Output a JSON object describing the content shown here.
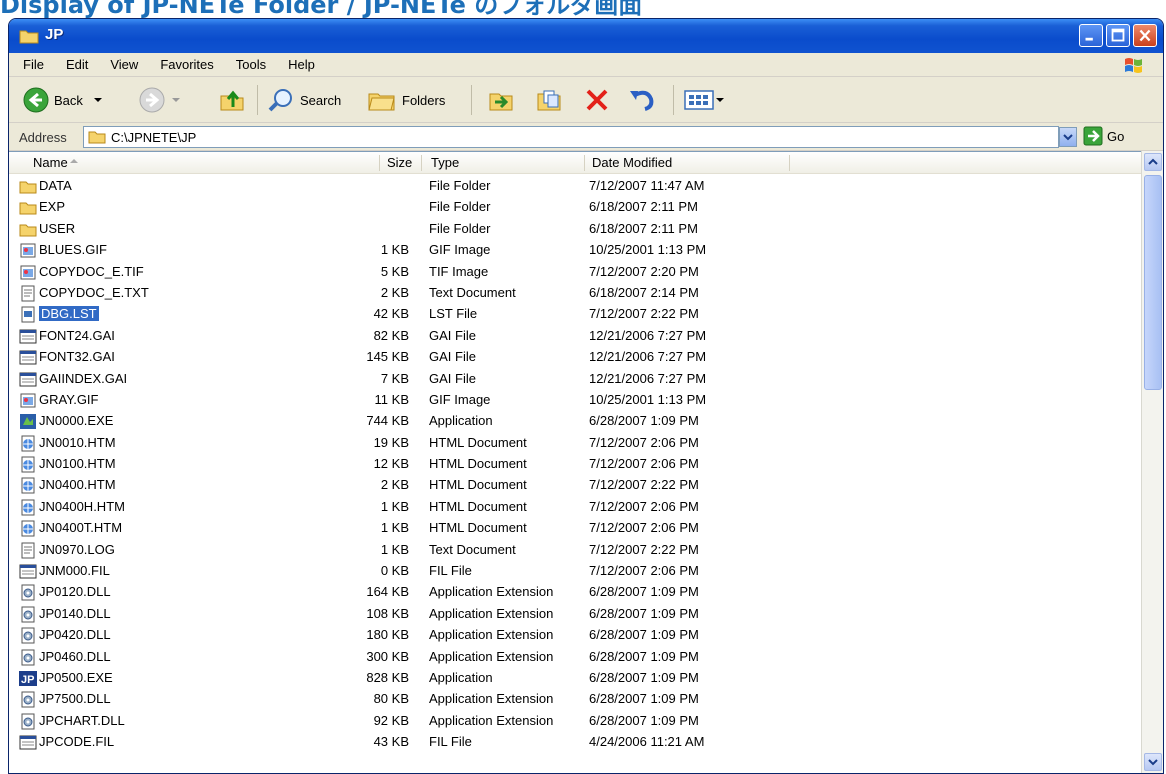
{
  "caption": "Display of JP-NETe Folder / JP-NETe のフォルダ画面",
  "window": {
    "title": "JP",
    "caption_buttons": [
      "minimize-icon",
      "maximize-icon",
      "close-icon"
    ]
  },
  "menu": [
    "File",
    "Edit",
    "View",
    "Favorites",
    "Tools",
    "Help"
  ],
  "toolbar": {
    "back": "Back",
    "search": "Search",
    "folders": "Folders"
  },
  "address": {
    "label": "Address",
    "value": "C:\\JPNETE\\JP",
    "go": "Go"
  },
  "columns": {
    "name": "Name",
    "size": "Size",
    "type": "Type",
    "date": "Date Modified"
  },
  "files": [
    {
      "name": "DATA",
      "size": "",
      "type": "File Folder",
      "date": "7/12/2007 11:47 AM",
      "icon": "folder"
    },
    {
      "name": "EXP",
      "size": "",
      "type": "File Folder",
      "date": "6/18/2007 2:11 PM",
      "icon": "folder"
    },
    {
      "name": "USER",
      "size": "",
      "type": "File Folder",
      "date": "6/18/2007 2:11 PM",
      "icon": "folder"
    },
    {
      "name": "BLUES.GIF",
      "size": "1 KB",
      "type": "GIF Image",
      "date": "10/25/2001 1:13 PM",
      "icon": "image"
    },
    {
      "name": "COPYDOC_E.TIF",
      "size": "5 KB",
      "type": "TIF Image",
      "date": "7/12/2007 2:20 PM",
      "icon": "image"
    },
    {
      "name": "COPYDOC_E.TXT",
      "size": "2 KB",
      "type": "Text Document",
      "date": "6/18/2007 2:14 PM",
      "icon": "text"
    },
    {
      "name": "DBG.LST",
      "size": "42 KB",
      "type": "LST File",
      "date": "7/12/2007 2:22 PM",
      "icon": "file",
      "selected": true
    },
    {
      "name": "FONT24.GAI",
      "size": "82 KB",
      "type": "GAI File",
      "date": "12/21/2006 7:27 PM",
      "icon": "window"
    },
    {
      "name": "FONT32.GAI",
      "size": "145 KB",
      "type": "GAI File",
      "date": "12/21/2006 7:27 PM",
      "icon": "window"
    },
    {
      "name": "GAIINDEX.GAI",
      "size": "7 KB",
      "type": "GAI File",
      "date": "12/21/2006 7:27 PM",
      "icon": "window"
    },
    {
      "name": "GRAY.GIF",
      "size": "11 KB",
      "type": "GIF Image",
      "date": "10/25/2001 1:13 PM",
      "icon": "image"
    },
    {
      "name": "JN0000.EXE",
      "size": "744 KB",
      "type": "Application",
      "date": "6/28/2007 1:09 PM",
      "icon": "app"
    },
    {
      "name": "JN0010.HTM",
      "size": "19 KB",
      "type": "HTML Document",
      "date": "7/12/2007 2:06 PM",
      "icon": "html"
    },
    {
      "name": "JN0100.HTM",
      "size": "12 KB",
      "type": "HTML Document",
      "date": "7/12/2007 2:06 PM",
      "icon": "html"
    },
    {
      "name": "JN0400.HTM",
      "size": "2 KB",
      "type": "HTML Document",
      "date": "7/12/2007 2:22 PM",
      "icon": "html"
    },
    {
      "name": "JN0400H.HTM",
      "size": "1 KB",
      "type": "HTML Document",
      "date": "7/12/2007 2:06 PM",
      "icon": "html"
    },
    {
      "name": "JN0400T.HTM",
      "size": "1 KB",
      "type": "HTML Document",
      "date": "7/12/2007 2:06 PM",
      "icon": "html"
    },
    {
      "name": "JN0970.LOG",
      "size": "1 KB",
      "type": "Text Document",
      "date": "7/12/2007 2:22 PM",
      "icon": "text"
    },
    {
      "name": "JNM000.FIL",
      "size": "0 KB",
      "type": "FIL File",
      "date": "7/12/2007 2:06 PM",
      "icon": "window"
    },
    {
      "name": "JP0120.DLL",
      "size": "164 KB",
      "type": "Application Extension",
      "date": "6/28/2007 1:09 PM",
      "icon": "dll"
    },
    {
      "name": "JP0140.DLL",
      "size": "108 KB",
      "type": "Application Extension",
      "date": "6/28/2007 1:09 PM",
      "icon": "dll"
    },
    {
      "name": "JP0420.DLL",
      "size": "180 KB",
      "type": "Application Extension",
      "date": "6/28/2007 1:09 PM",
      "icon": "dll"
    },
    {
      "name": "JP0460.DLL",
      "size": "300 KB",
      "type": "Application Extension",
      "date": "6/28/2007 1:09 PM",
      "icon": "dll"
    },
    {
      "name": "JP0500.EXE",
      "size": "828 KB",
      "type": "Application",
      "date": "6/28/2007 1:09 PM",
      "icon": "jp-app"
    },
    {
      "name": "JP7500.DLL",
      "size": "80 KB",
      "type": "Application Extension",
      "date": "6/28/2007 1:09 PM",
      "icon": "dll"
    },
    {
      "name": "JPCHART.DLL",
      "size": "92 KB",
      "type": "Application Extension",
      "date": "6/28/2007 1:09 PM",
      "icon": "dll"
    },
    {
      "name": "JPCODE.FIL",
      "size": "43 KB",
      "type": "FIL File",
      "date": "4/24/2006 11:21 AM",
      "icon": "window"
    }
  ],
  "colors": {
    "titlebar": "#0a4ccc",
    "selection": "#316ac5",
    "chrome": "#ece9d8"
  }
}
